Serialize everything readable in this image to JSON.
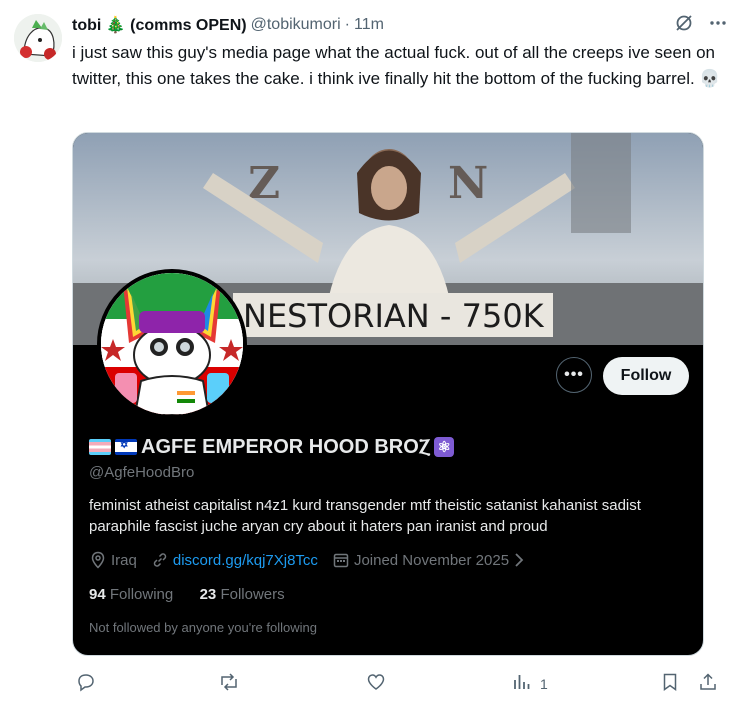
{
  "tweet": {
    "display_name": "tobi 🎄 (comms OPEN)",
    "handle": "@tobikumori",
    "separator": "·",
    "time": "11m",
    "text": "i just saw this guy's media page what the actual fuck. out of all the creeps ive seen on twitter, this one takes the cake. i think ive finally hit the bottom of the fucking barrel. 💀"
  },
  "card": {
    "banner_caption": "NESTORIAN - 750K",
    "more_label": "•••",
    "follow_label": "Follow",
    "profile_name": "AGFE EMPEROR HOOD BROⲌ",
    "profile_handle": "@AgfeHoodBro",
    "bio": "feminist atheist capitalist n4z1 kurd transgender mtf theistic satanist kahanist sadist paraphile fascist juche aryan cry about it haters pan iranist and proud",
    "location": "Iraq",
    "link": "discord.gg/kqj7Xj8Tcc",
    "joined": "Joined November 2025",
    "following_count": "94",
    "following_label": "Following",
    "followers_count": "23",
    "followers_label": "Followers",
    "not_followed": "Not followed by anyone you're following"
  },
  "actions": {
    "views_count": "1"
  },
  "icons": {
    "header_grok": "grok-icon",
    "header_more": "more-icon",
    "reply": "reply-icon",
    "retweet": "retweet-icon",
    "like": "like-icon",
    "views": "views-icon",
    "bookmark": "bookmark-icon",
    "share": "share-icon"
  },
  "colors": {
    "link": "#1d9bf0",
    "follow_bg": "#eff3f4",
    "card_bg": "#000000",
    "muted": "#536471"
  }
}
